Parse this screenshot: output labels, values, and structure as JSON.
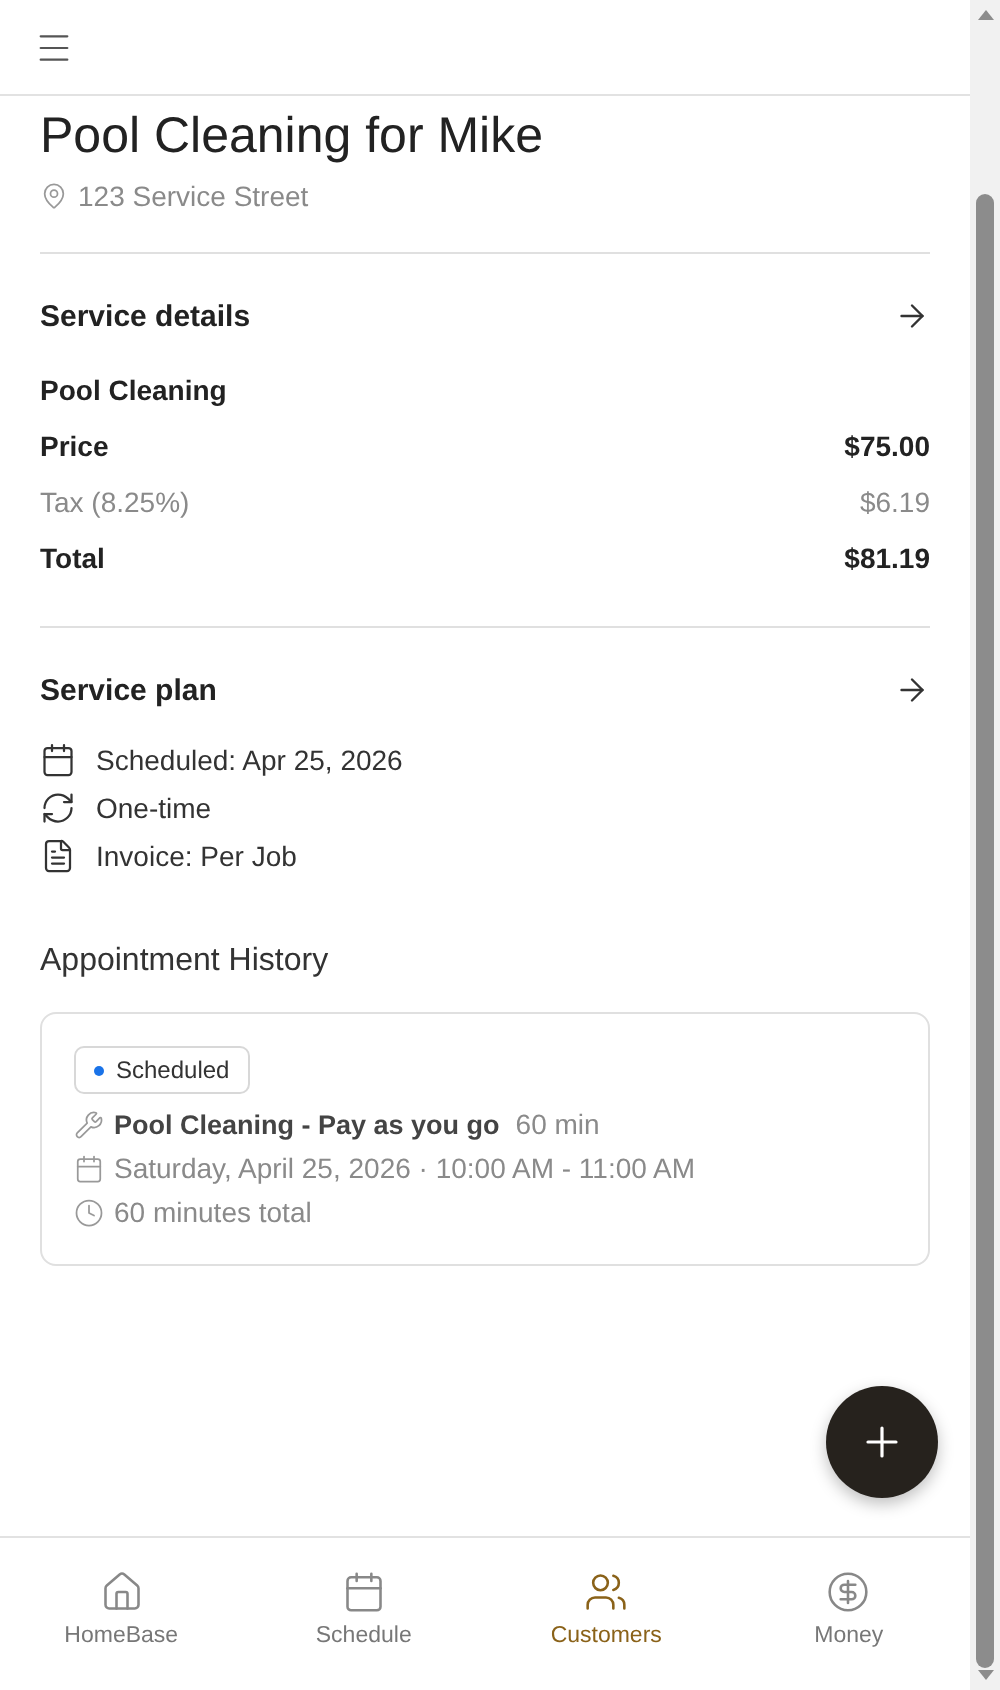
{
  "title": "Pool Cleaning for Mike",
  "address": "123 Service Street",
  "service_details": {
    "heading": "Service details",
    "service": "Pool Cleaning",
    "lines": [
      {
        "kind": "strong",
        "label": "Price",
        "value": "$75.00"
      },
      {
        "kind": "muted",
        "label": "Tax (8.25%)",
        "value": "$6.19"
      },
      {
        "kind": "strong",
        "label": "Total",
        "value": "$81.19"
      }
    ]
  },
  "service_plan": {
    "heading": "Service plan",
    "items": [
      {
        "kind": "calendar",
        "text": "Scheduled: Apr 25, 2026"
      },
      {
        "kind": "repeat",
        "text": "One-time"
      },
      {
        "kind": "invoice",
        "text": "Invoice: Per Job"
      }
    ]
  },
  "history": {
    "heading": "Appointment History",
    "appointments": [
      {
        "status": "Scheduled",
        "color": "#1a73e8",
        "service": "Pool Cleaning - Pay as you go",
        "duration": "60 min",
        "when": "Saturday, April 25, 2026 · 10:00 AM - 11:00 AM",
        "total": "60 minutes total"
      }
    ]
  },
  "nav": [
    {
      "kind": "home",
      "label": "HomeBase",
      "selected": false
    },
    {
      "kind": "calendar",
      "label": "Schedule",
      "selected": false
    },
    {
      "kind": "users",
      "label": "Customers",
      "selected": true
    },
    {
      "kind": "money",
      "label": "Money",
      "selected": false
    }
  ]
}
